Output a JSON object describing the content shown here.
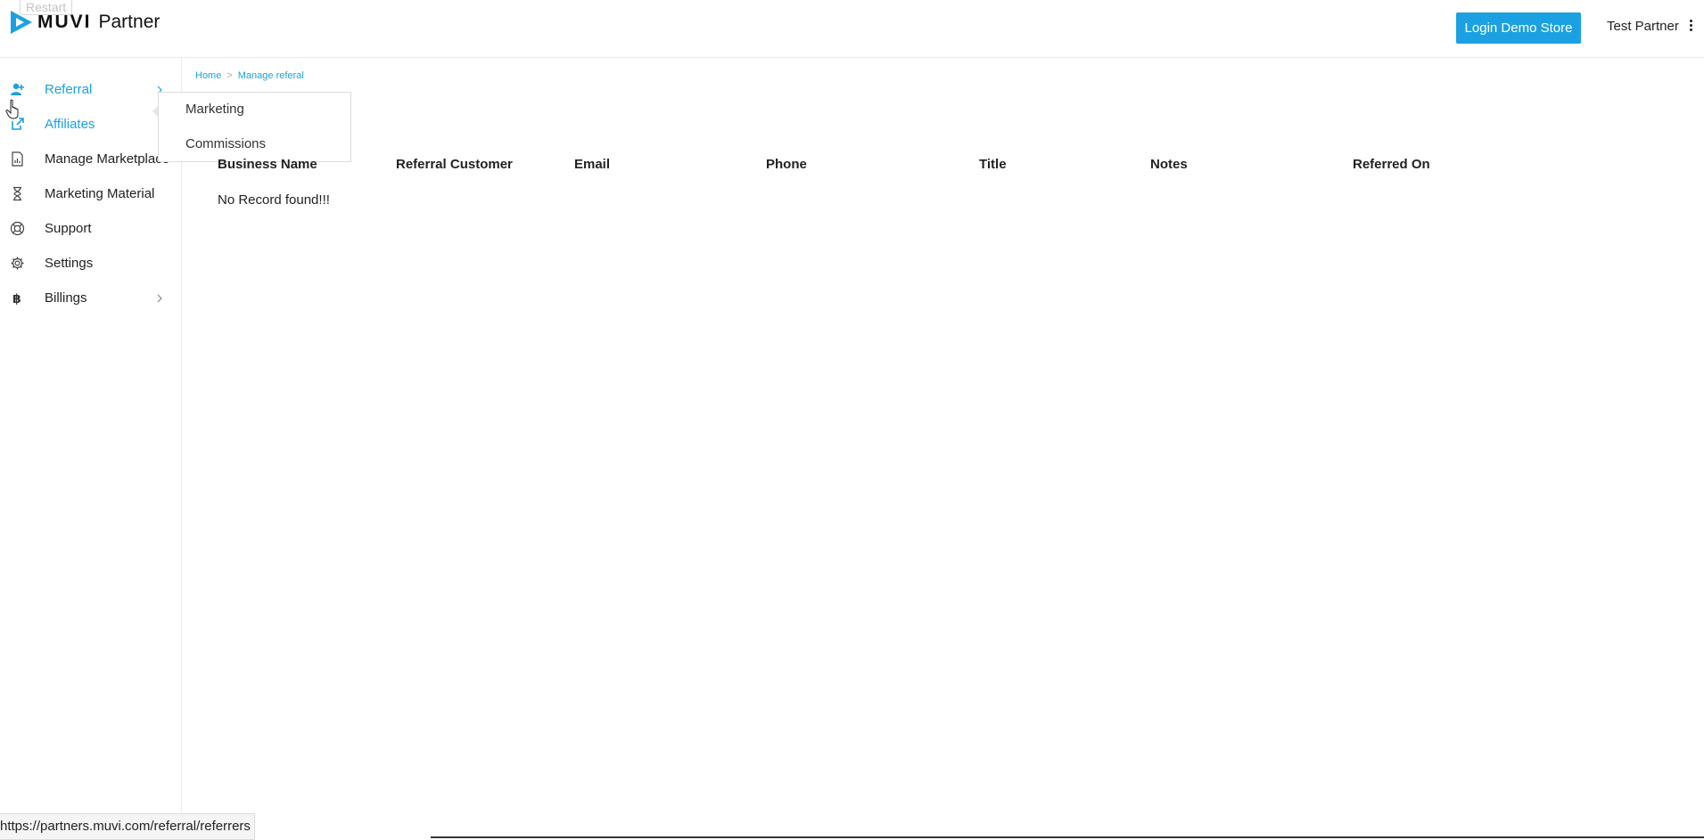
{
  "header": {
    "restart_label": "Restart",
    "logo_brand": "MUVI",
    "logo_suffix": "Partner",
    "login_demo_store_label": "Login Demo Store",
    "user_name": "Test Partner"
  },
  "sidebar": {
    "items": [
      {
        "label": "Referral",
        "icon": "user-plus-icon",
        "active": true,
        "has_chevron": true
      },
      {
        "label": "Affiliates",
        "icon": "external-link-icon",
        "active": true,
        "has_chevron": false
      },
      {
        "label": "Manage Marketplace",
        "icon": "document-chart-icon",
        "active": false,
        "has_chevron": false
      },
      {
        "label": "Marketing Material",
        "icon": "hourglass-icon",
        "active": false,
        "has_chevron": false
      },
      {
        "label": "Support",
        "icon": "lifebuoy-icon",
        "active": false,
        "has_chevron": false
      },
      {
        "label": "Settings",
        "icon": "gear-icon",
        "active": false,
        "has_chevron": false
      },
      {
        "label": "Billings",
        "icon": "bitcoin-icon",
        "active": false,
        "has_chevron": true
      }
    ]
  },
  "submenu": {
    "items": [
      "Marketing",
      "Commissions"
    ]
  },
  "breadcrumb": {
    "home": "Home",
    "separator": ">",
    "current": "Manage referal"
  },
  "table": {
    "columns": [
      "Business Name",
      "Referral Customer",
      "Email",
      "Phone",
      "Title",
      "Notes",
      "Referred On"
    ],
    "empty_message": "No Record found!!!"
  },
  "status_bar": {
    "url": "https://partners.muvi.com/referral/referrers"
  },
  "colors": {
    "accent": "#1ba1e2",
    "text": "#222222"
  }
}
